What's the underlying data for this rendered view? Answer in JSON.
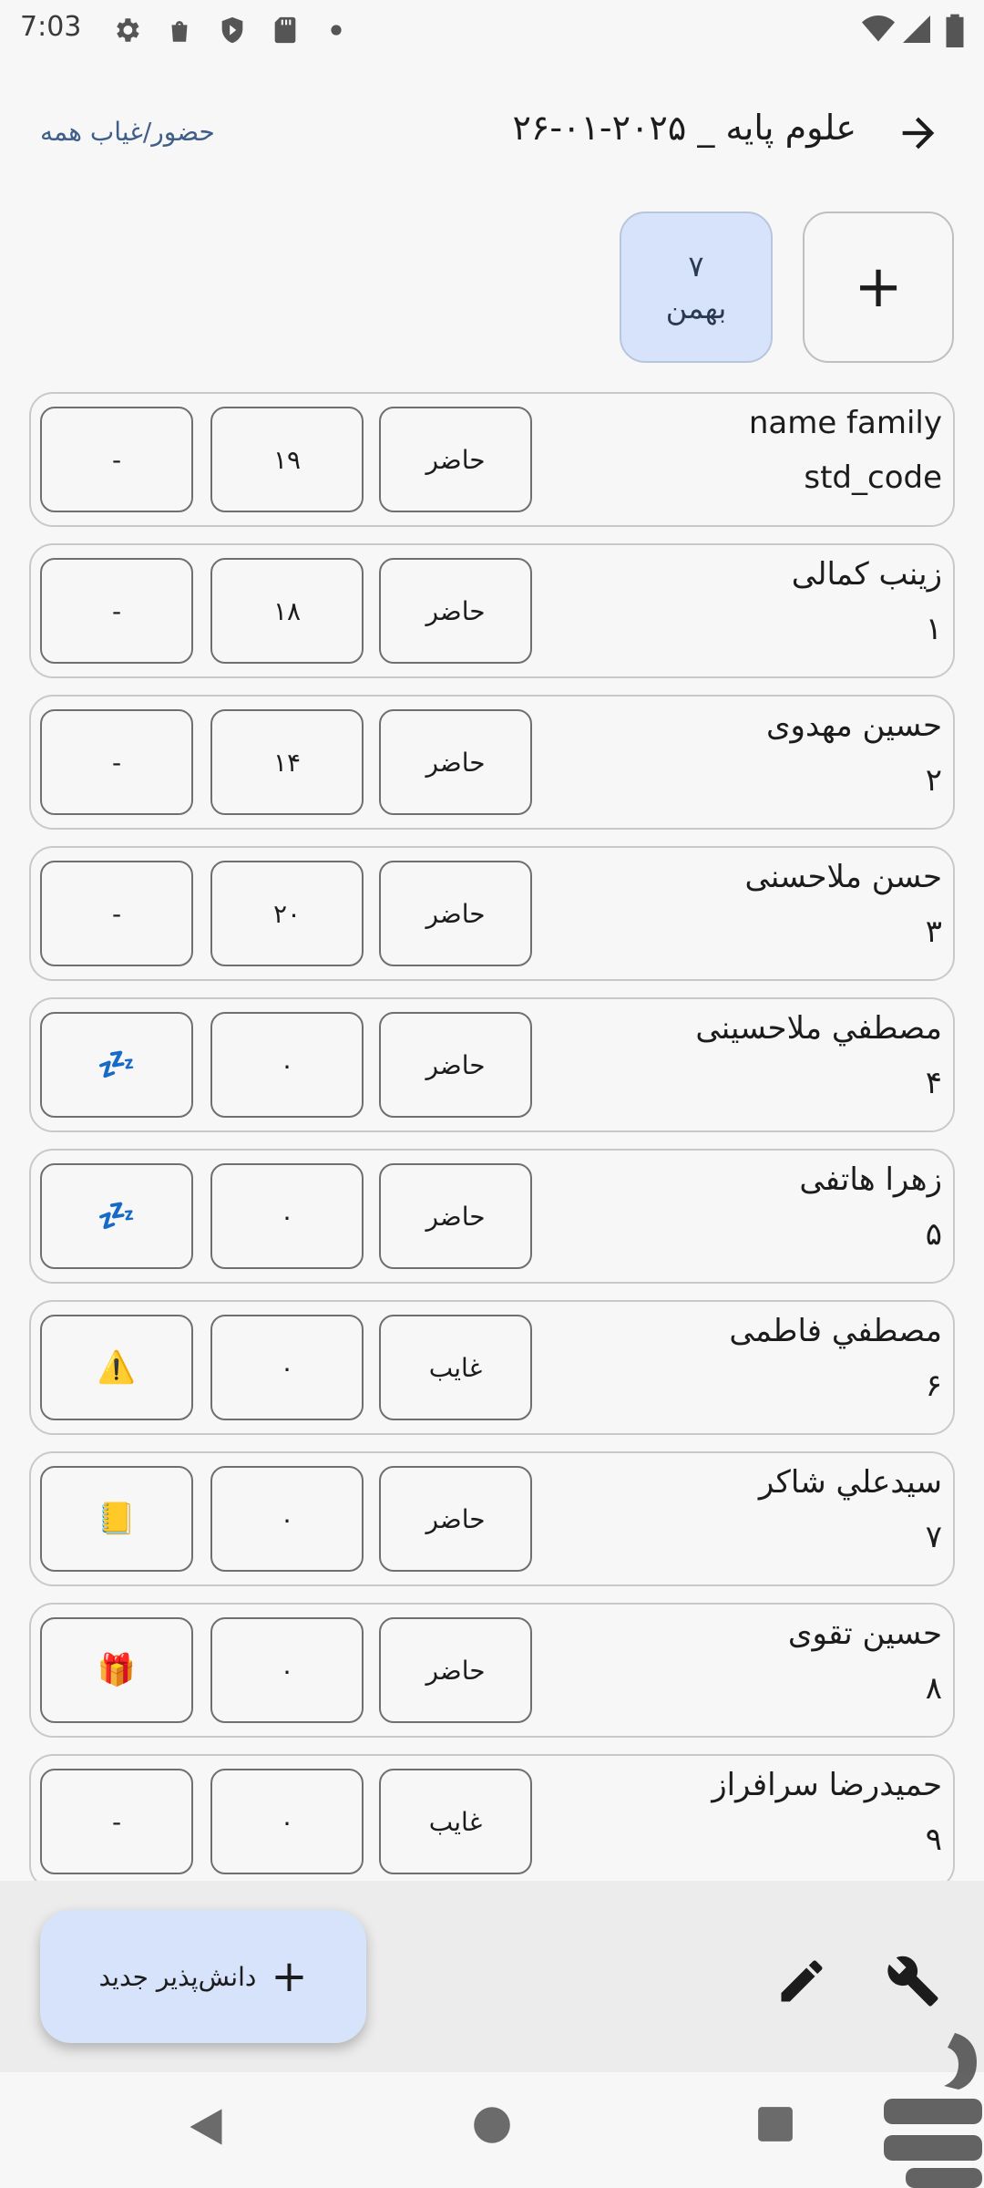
{
  "status_bar": {
    "time": "7:03"
  },
  "header": {
    "title": "علوم پایه _ ۲۰۲۵-۰۱-۲۶",
    "attendance_all": "حضور/غیاب همه"
  },
  "dates": {
    "add_label": "+",
    "chips": [
      {
        "day": "۷",
        "month": "بهمن"
      }
    ]
  },
  "students": [
    {
      "name": "name family",
      "code": "std_code",
      "status": "حاضر",
      "score": "۱۹",
      "note": "-"
    },
    {
      "name": "زینب کمالی",
      "code": "۱",
      "status": "حاضر",
      "score": "۱۸",
      "note": "-"
    },
    {
      "name": "حسین مهدوی",
      "code": "۲",
      "status": "حاضر",
      "score": "۱۴",
      "note": "-"
    },
    {
      "name": "حسن ملاحسنی",
      "code": "۳",
      "status": "حاضر",
      "score": "۲۰",
      "note": "-"
    },
    {
      "name": "مصطفي ملاحسینی",
      "code": "۴",
      "status": "حاضر",
      "score": "۰",
      "note": "💤"
    },
    {
      "name": "زهرا هاتفی",
      "code": "۵",
      "status": "حاضر",
      "score": "۰",
      "note": "💤"
    },
    {
      "name": "مصطفي فاطمی",
      "code": "۶",
      "status": "غایب",
      "score": "۰",
      "note": "⚠️"
    },
    {
      "name": "سیدعلي شاکر",
      "code": "۷",
      "status": "حاضر",
      "score": "۰",
      "note": "📒"
    },
    {
      "name": "حسین تقوی",
      "code": "۸",
      "status": "حاضر",
      "score": "۰",
      "note": "🎁"
    },
    {
      "name": "حمیدرضا سرافراز",
      "code": "۹",
      "status": "غایب",
      "score": "۰",
      "note": "-"
    }
  ],
  "bottom_bar": {
    "fab_label": "دانش‌پذیر جدید",
    "fab_plus": "+",
    "icons": [
      "edit-icon",
      "wrench-icon"
    ]
  },
  "nav_bar": {
    "icons": [
      "back-icon",
      "home-icon",
      "recents-icon"
    ]
  },
  "colors": {
    "accent": "#d6e3fb",
    "link": "#3f5f8a",
    "outline": "#6f6f6f"
  }
}
